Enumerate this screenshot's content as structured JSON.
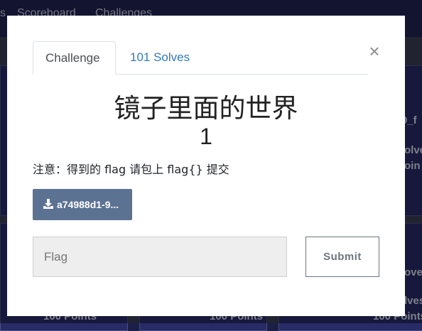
{
  "nav": {
    "items": [
      "s",
      "Scoreboard",
      "Challenges"
    ]
  },
  "background_cards": {
    "right_top": [
      "9_f",
      "olve",
      "oin"
    ],
    "right_bottom": [
      "ove",
      "lves",
      "oin"
    ],
    "bottom_points": [
      "100 Points",
      "100 Points",
      "100 Points"
    ]
  },
  "modal": {
    "tabs": [
      {
        "label": "Challenge",
        "active": true
      },
      {
        "label": "101 Solves",
        "active": false
      }
    ],
    "close_symbol": "×",
    "challenge_name": "镜子里面的世界",
    "points": "1",
    "description": "注意：得到的 flag 请包上 flag{} 提交",
    "file_button": {
      "label": "a74988d1-9...",
      "icon": "download-icon"
    },
    "flag_input": {
      "placeholder": "Flag",
      "value": ""
    },
    "submit_label": "Submit"
  },
  "colors": {
    "nav_bg": "#1f2453",
    "card_bg": "#272b66",
    "file_button_bg": "#5c7293",
    "tab_link": "#337ab7"
  }
}
